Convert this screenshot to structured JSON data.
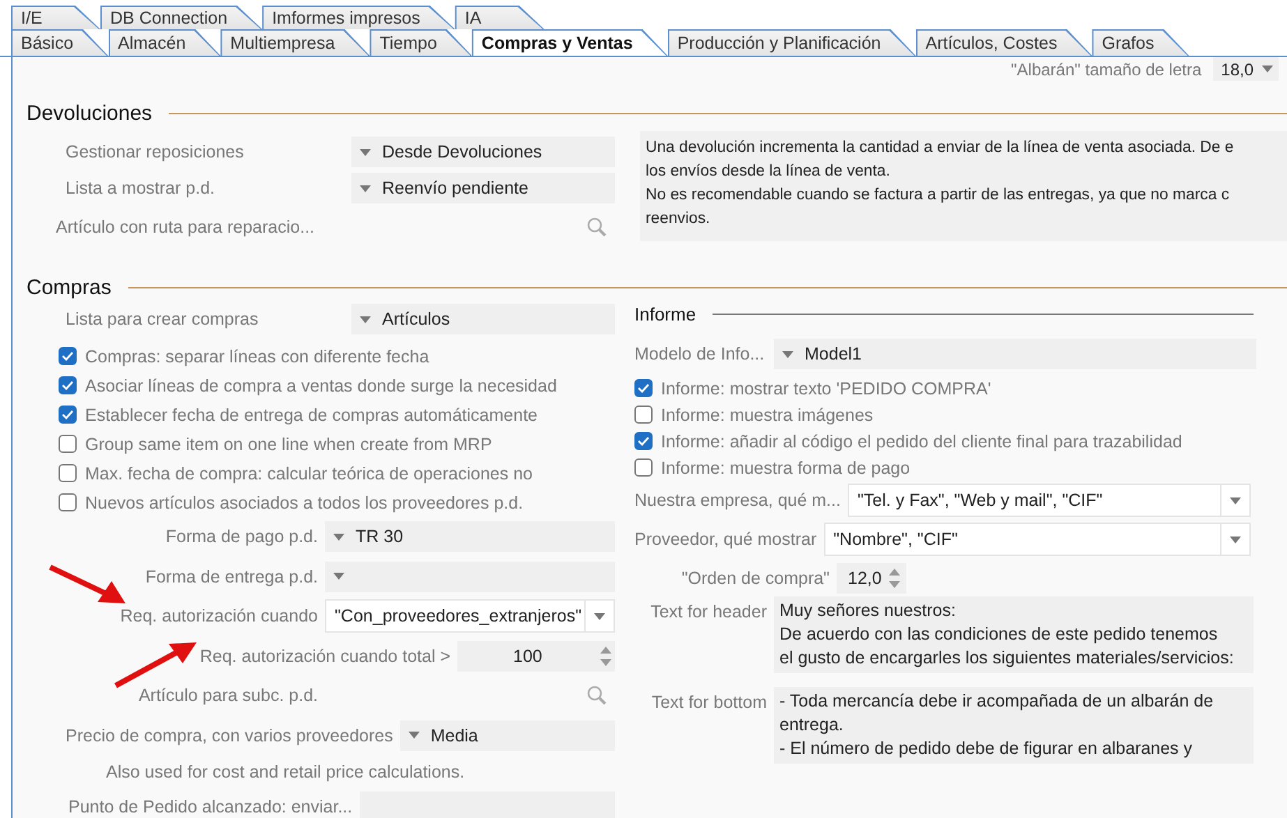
{
  "tabs_row_1": [
    {
      "label": "I/E",
      "selected": false
    },
    {
      "label": "DB Connection",
      "selected": false
    },
    {
      "label": "Imformes impresos",
      "selected": false
    },
    {
      "label": "IA",
      "selected": false
    }
  ],
  "tabs_row_2": [
    {
      "label": "Básico",
      "selected": false
    },
    {
      "label": "Almacén",
      "selected": false
    },
    {
      "label": "Multiempresa",
      "selected": false
    },
    {
      "label": "Tiempo",
      "selected": false
    },
    {
      "label": "Compras y Ventas",
      "selected": true
    },
    {
      "label": "Producción y Planificación",
      "selected": false
    },
    {
      "label": "Artículos, Costes",
      "selected": false
    },
    {
      "label": "Grafos",
      "selected": false
    }
  ],
  "top_setting": {
    "label": "\"Albarán\" tamaño de letra",
    "value": "18,0"
  },
  "devoluciones": {
    "title": "Devoluciones",
    "fields": [
      {
        "kind": "select",
        "label": "Gestionar reposiciones",
        "value": "Desde Devoluciones"
      },
      {
        "kind": "select",
        "label": "Lista a mostrar p.d.",
        "value": "Reenvío pendiente"
      },
      {
        "kind": "search",
        "label": "Artículo con ruta para reparacio..."
      }
    ],
    "description": "Una devolución incrementa la cantidad a enviar de la línea de venta asociada. De e\nlos envíos desde la línea de venta.\nNo es recomendable cuando se factura a partir de las entregas, ya que no marca c\nreenvios."
  },
  "compras": {
    "title": "Compras",
    "fields": [
      {
        "kind": "select",
        "label": "Lista para crear compras",
        "value": "Artículos"
      },
      {
        "kind": "checkbox",
        "label": "Compras: separar líneas con diferente fecha",
        "checked": true
      },
      {
        "kind": "checkbox",
        "label": "Asociar líneas de compra a ventas donde surge la necesidad",
        "checked": true
      },
      {
        "kind": "checkbox",
        "label": "Establecer fecha de entrega de compras automáticamente",
        "checked": true
      },
      {
        "kind": "checkbox",
        "label": "Group same item on one line when create from MRP",
        "checked": false
      },
      {
        "kind": "checkbox",
        "label": "Max. fecha de compra: calcular teórica de operaciones no",
        "checked": false
      },
      {
        "kind": "checkbox",
        "label": "Nuevos artículos asociados a todos los proveedores p.d.",
        "checked": false
      },
      {
        "kind": "select",
        "label": "Forma de pago p.d.",
        "value": "TR 30"
      },
      {
        "kind": "select",
        "label": "Forma de entrega p.d."
      },
      {
        "kind": "combo",
        "label": "Req. autorización cuando",
        "value": "\"Con_proveedores_extranjeros\""
      },
      {
        "kind": "spin",
        "label": "Req. autorización cuando total >",
        "value": "100"
      },
      {
        "kind": "search",
        "label": "Artículo para subc. p.d."
      },
      {
        "kind": "select",
        "label": "Precio de compra, con varios proveedores",
        "value": "Media"
      },
      {
        "kind": "note",
        "label": "Also used for cost and retail price calculations."
      },
      {
        "kind": "field",
        "label": "Punto de Pedido alcanzado: enviar..."
      }
    ],
    "informe": {
      "title": "Informe",
      "fields": [
        {
          "kind": "select",
          "label": "Modelo de Info...",
          "value": "Model1"
        },
        {
          "kind": "checkbox",
          "label": "Informe: mostrar texto 'PEDIDO COMPRA'",
          "checked": true
        },
        {
          "kind": "checkbox",
          "label": "Informe: muestra imágenes",
          "checked": false
        },
        {
          "kind": "checkbox",
          "label": "Informe: añadir al código el pedido del cliente final para trazabilidad",
          "checked": true
        },
        {
          "kind": "checkbox",
          "label": "Informe: muestra forma de pago",
          "checked": false
        },
        {
          "kind": "combo",
          "label": "Nuestra empresa, qué m...",
          "value": "\"Tel. y Fax\", \"Web y mail\", \"CIF\""
        },
        {
          "kind": "combo",
          "label": "Proveedor, qué mostrar",
          "value": "\"Nombre\", \"CIF\""
        },
        {
          "kind": "spin",
          "label": "\"Orden de compra\"",
          "value": "12,0"
        },
        {
          "kind": "text",
          "label": "Text for header",
          "value": "Muy señores nuestros:\nDe acuerdo con las condiciones de este pedido tenemos\nel gusto de encargarles los siguientes materiales/servicios:"
        },
        {
          "kind": "text",
          "label": "Text for bottom",
          "value": "- Toda mercancía debe ir acompañada de un albarán de\nentrega.\n- El número de pedido debe de figurar en albaranes y"
        }
      ]
    }
  }
}
